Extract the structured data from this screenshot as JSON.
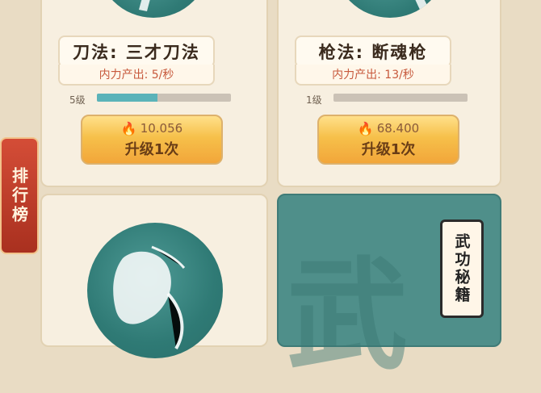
{
  "sidebar": {
    "rank_label": "排行榜"
  },
  "cards": [
    {
      "skill_name": "刀法: 三才刀法",
      "output_text": "内力产出: 5/秒",
      "level": "5级",
      "progress": 0.45,
      "cost": "10.056",
      "button_label": "升级1次"
    },
    {
      "skill_name": "枪法: 断魂枪",
      "output_text": "内力产出: 13/秒",
      "level": "1级",
      "progress": 0.0,
      "cost": "68.400",
      "button_label": "升级1次"
    }
  ],
  "secret_book": {
    "label": "武功秘籍",
    "watermark": "武"
  },
  "icons": {
    "fire": "fire-icon"
  },
  "colors": {
    "accent": "#5ab3b9",
    "button": "#f6c04a",
    "tab": "#c0402d"
  }
}
